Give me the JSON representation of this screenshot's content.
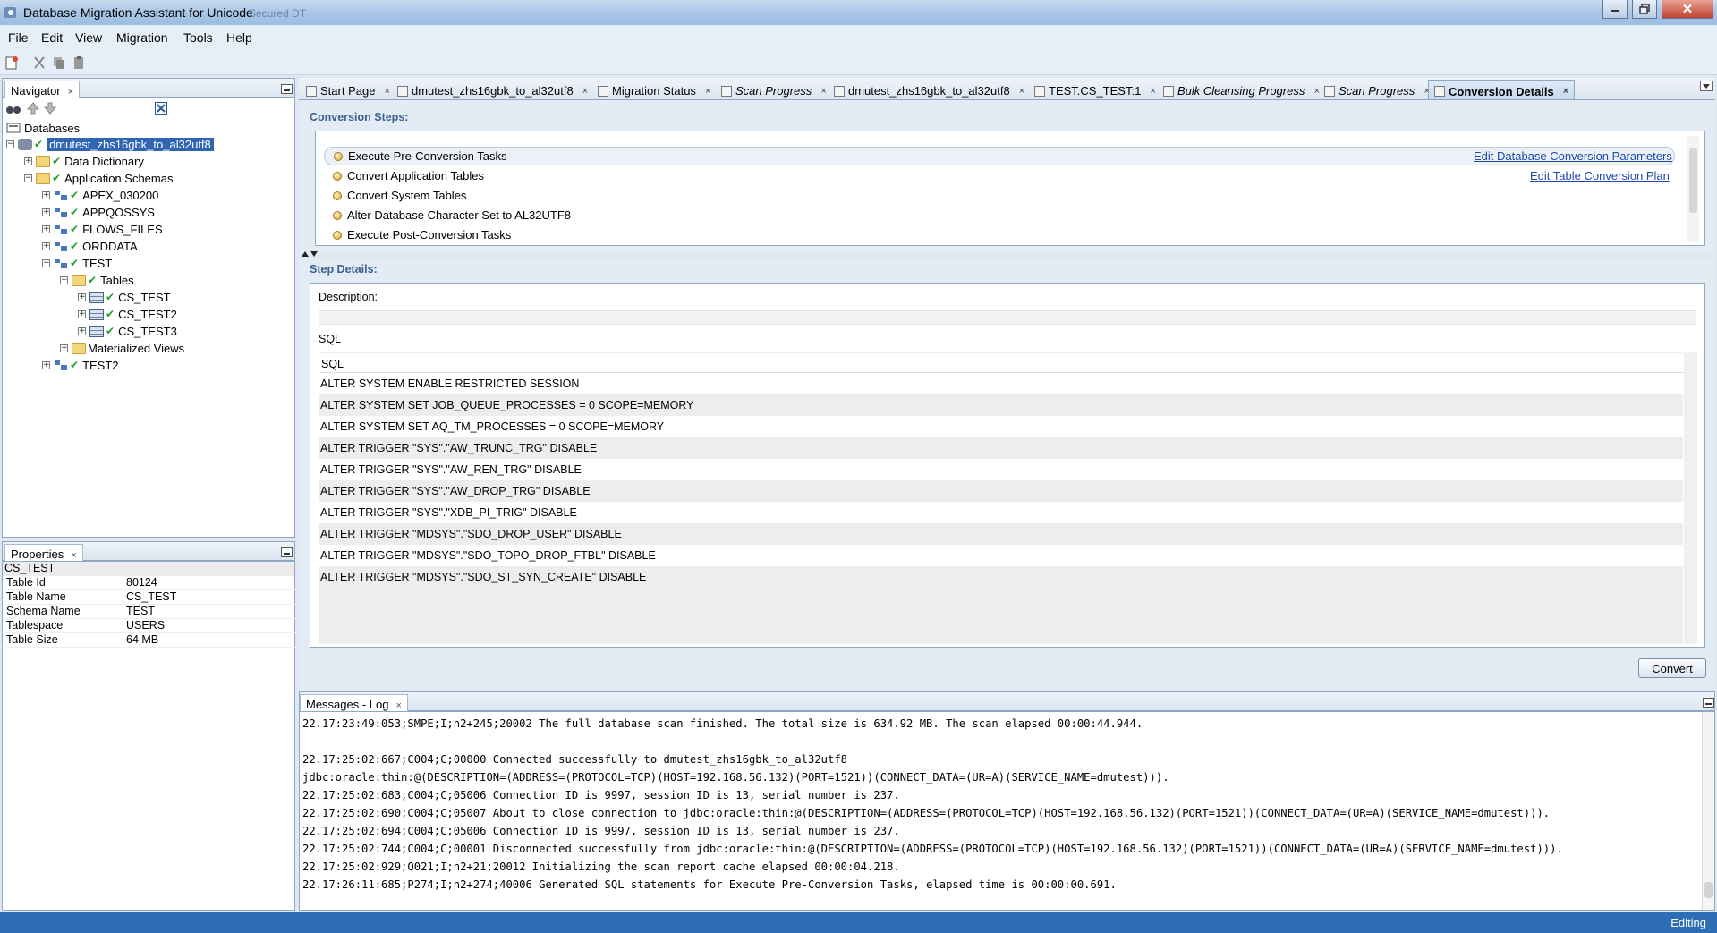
{
  "window": {
    "title": "Database Migration Assistant for Unicode",
    "subtitle_blur": "Secured DT"
  },
  "menu": [
    "File",
    "Edit",
    "View",
    "Migration",
    "Tools",
    "Help"
  ],
  "navigator": {
    "tab_label": "Navigator",
    "root_label": "Databases",
    "db_label": "dmutest_zhs16gbk_to_al32utf8",
    "items": [
      "Data Dictionary",
      "Application Schemas",
      "APEX_030200",
      "APPQOSSYS",
      "FLOWS_FILES",
      "ORDDATA",
      "TEST",
      "Tables",
      "CS_TEST",
      "CS_TEST2",
      "CS_TEST3",
      "Materialized Views",
      "TEST2"
    ]
  },
  "properties": {
    "tab_label": "Properties",
    "object": "CS_TEST",
    "rows": [
      {
        "k": "Table Id",
        "v": "80124"
      },
      {
        "k": "Table Name",
        "v": "CS_TEST"
      },
      {
        "k": "Schema Name",
        "v": "TEST"
      },
      {
        "k": "Tablespace",
        "v": "USERS"
      },
      {
        "k": "Table Size",
        "v": "64 MB"
      }
    ]
  },
  "editor_tabs": [
    "Start Page",
    "dmutest_zhs16gbk_to_al32utf8",
    "Migration Status",
    "Scan Progress",
    "dmutest_zhs16gbk_to_al32utf8",
    "TEST.CS_TEST:1",
    "Bulk Cleansing Progress",
    "Scan Progress",
    "Conversion Details"
  ],
  "conversion": {
    "steps_label": "Conversion Steps:",
    "steps": [
      "Execute Pre-Conversion Tasks",
      "Convert Application Tables",
      "Convert System Tables",
      "Alter Database Character Set to AL32UTF8",
      "Execute Post-Conversion Tasks"
    ],
    "link_params": "Edit Database Conversion Parameters",
    "link_plan": "Edit Table Conversion Plan",
    "details_label": "Step Details:",
    "description_label": "Description:",
    "sql_label": "SQL",
    "sql_col": "SQL",
    "sql_rows": [
      "ALTER SYSTEM ENABLE RESTRICTED SESSION",
      "ALTER SYSTEM SET JOB_QUEUE_PROCESSES = 0 SCOPE=MEMORY",
      "ALTER SYSTEM SET AQ_TM_PROCESSES = 0 SCOPE=MEMORY",
      "ALTER TRIGGER \"SYS\".\"AW_TRUNC_TRG\" DISABLE",
      "ALTER TRIGGER \"SYS\".\"AW_REN_TRG\" DISABLE",
      "ALTER TRIGGER \"SYS\".\"AW_DROP_TRG\" DISABLE",
      "ALTER TRIGGER \"SYS\".\"XDB_PI_TRIG\" DISABLE",
      "ALTER TRIGGER \"MDSYS\".\"SDO_DROP_USER\" DISABLE",
      "ALTER TRIGGER \"MDSYS\".\"SDO_TOPO_DROP_FTBL\" DISABLE",
      "ALTER TRIGGER \"MDSYS\".\"SDO_ST_SYN_CREATE\" DISABLE"
    ],
    "convert_button": "Convert"
  },
  "messages": {
    "tab_label": "Messages - Log",
    "lines": [
      "22.17:23:49:053;SMPE;I;n2+245;20002 The full database scan finished. The total size is 634.92 MB. The scan elapsed 00:00:44.944.",
      "",
      "22.17:25:02:667;C004;C;00000 Connected successfully to dmutest_zhs16gbk_to_al32utf8",
      "jdbc:oracle:thin:@(DESCRIPTION=(ADDRESS=(PROTOCOL=TCP)(HOST=192.168.56.132)(PORT=1521))(CONNECT_DATA=(UR=A)(SERVICE_NAME=dmutest))).",
      "22.17:25:02:683;C004;C;05006 Connection ID is 9997, session ID is 13, serial number is 237.",
      "22.17:25:02:690;C004;C;05007 About to close connection to jdbc:oracle:thin:@(DESCRIPTION=(ADDRESS=(PROTOCOL=TCP)(HOST=192.168.56.132)(PORT=1521))(CONNECT_DATA=(UR=A)(SERVICE_NAME=dmutest))).",
      "22.17:25:02:694;C004;C;05006 Connection ID is 9997, session ID is 13, serial number is 237.",
      "22.17:25:02:744;C004;C;00001 Disconnected successfully from jdbc:oracle:thin:@(DESCRIPTION=(ADDRESS=(PROTOCOL=TCP)(HOST=192.168.56.132)(PORT=1521))(CONNECT_DATA=(UR=A)(SERVICE_NAME=dmutest))).",
      "22.17:25:02:929;Q021;I;n2+21;20012 Initializing the scan report cache elapsed 00:00:04.218.",
      "22.17:26:11:685;P274;I;n2+274;40006 Generated SQL statements for Execute Pre-Conversion Tasks, elapsed time is 00:00:00.691."
    ]
  },
  "status": {
    "text": "Editing"
  }
}
